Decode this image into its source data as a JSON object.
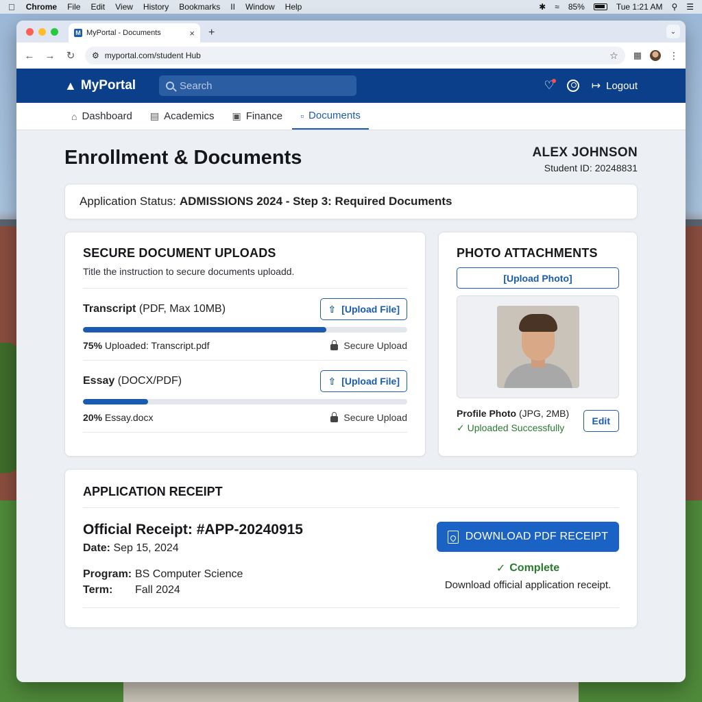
{
  "menubar": {
    "app": "Chrome",
    "items": [
      "File",
      "Edit",
      "View",
      "History",
      "Bookmarks",
      "Window",
      "Help"
    ],
    "battery": "85%",
    "clock": "Tue 1:21 AM"
  },
  "browser": {
    "tab_title": "MyPortal - Documents",
    "favicon_letter": "M",
    "url": "myportal.com/student Hub"
  },
  "portal": {
    "brand": "MyPortal",
    "search_placeholder": "Search",
    "logout_label": "Logout"
  },
  "nav": {
    "tabs": [
      {
        "label": "Dashboard",
        "active": false
      },
      {
        "label": "Academics",
        "active": false
      },
      {
        "label": "Finance",
        "active": false
      },
      {
        "label": "Documents",
        "active": true
      }
    ]
  },
  "page": {
    "title": "Enrollment & Documents",
    "student_name": "ALEX JOHNSON",
    "student_id": "Student ID: 20248831"
  },
  "status": {
    "label": "Application Status:",
    "value": "ADMISSIONS 2024 - Step 3: Required Documents"
  },
  "uploads": {
    "title": "SECURE DOCUMENT UPLOADS",
    "subtitle": "Title the instruction to secure documents uploadd.",
    "upload_button": "[Upload File]",
    "secure_label": "Secure Upload",
    "items": [
      {
        "name": "Transcript",
        "format": "(PDF, Max 10MB)",
        "progress_label": "75%",
        "status": "Uploaded: Transcript.pdf",
        "progress": 0.75
      },
      {
        "name": "Essay",
        "format": "(DOCX/PDF)",
        "progress_label": "20%",
        "status": "Essay.docx",
        "progress": 0.2
      }
    ]
  },
  "photos": {
    "title": "PHOTO ATTACHMENTS",
    "upload_button": "[Upload Photo]",
    "photo_name": "Profile Photo",
    "photo_format": "(JPG, 2MB)",
    "status": "Uploaded Successfully",
    "edit_button": "Edit"
  },
  "receipt": {
    "title": "APPLICATION RECEIPT",
    "number": "Official Receipt: #APP-20240915",
    "date_label": "Date:",
    "date": "Sep 15, 2024",
    "program_label": "Program:",
    "program": "BS Computer Science",
    "term_label": "Term:",
    "term": "Fall 2024",
    "download_button": "DOWNLOAD PDF RECEIPT",
    "complete_label": "Complete",
    "description": "Download official application receipt."
  },
  "colors": {
    "header": "#0c3f8a",
    "accent": "#1a5bb0",
    "success": "#2a7a2e"
  }
}
